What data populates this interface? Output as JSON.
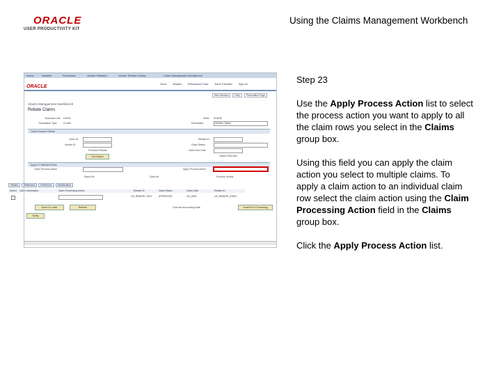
{
  "header": {
    "logo_brand": "ORACLE",
    "logo_product": "USER PRODUCTIVITY KIT",
    "doc_title": "Using the Claims Management Workbench"
  },
  "screenshot": {
    "nav_items": [
      "Home",
      "Worklist",
      "Processes",
      "Vendor Rebates",
      "Vendor Rebate Claims",
      "Claim Management Workbench"
    ],
    "brand": "ORACLE",
    "menu_items": [
      "Home",
      "Worklist",
      "Performance Trace",
      "Add to Favorites",
      "Sign out"
    ],
    "links": [
      "New Window",
      "Help",
      "Personalize Page"
    ],
    "page_title_small": "Claims Management Workbench",
    "page_title": "Rebate Claims",
    "fields": {
      "business_unit": "Business Unit",
      "business_unit_value": "US001",
      "transaction_type": "Transaction Type",
      "transaction_type_value": "CLAIM",
      "setid": "SetID",
      "setid_value": "SHARE",
      "description": "Description",
      "description_value": "Rebate Claims",
      "claim_id": "Claim ID",
      "vendor_id": "Vendor ID",
      "rebate_id": "Rebate ID",
      "claim_status": "Claim Status",
      "claim_due_date": "Claim Due Date",
      "purchase_rebate": "Purchase Rebate",
      "claims_past_due": "Claims Past Due"
    },
    "search_section": "Claims Search Criteria",
    "get_claims": "Get Claims",
    "apply_section": "Apply To Selected Rows",
    "process_action_label": "Claim Process Action",
    "apply_process_action_label": "Apply Process Action",
    "select_all": "Select All",
    "clear_all": "Clear All",
    "process_vendor": "Process Vendor",
    "claims_section": "Claims",
    "tabs": [
      "Details",
      "Settlement",
      "Reference",
      "Identification"
    ],
    "grid_headers": [
      "Select",
      "Claim Information",
      "Claim Processing Action",
      "Rebate ID",
      "Claim Status",
      "Claim Date",
      "Rebate ID"
    ],
    "grid_row": [
      "US_REBATE_0001",
      "APPROVED",
      "US_0001",
      "US_REBATE_00001"
    ],
    "override_label": "Override Accounting Date",
    "save_for_later": "Save For Later",
    "refresh": "Refresh",
    "submit_processing": "Submit For Processing",
    "notify": "Notify"
  },
  "panel": {
    "step": "Step 23",
    "p1": {
      "t1": "Use the ",
      "b1": "Apply Process Action",
      "t2": " list to select the process action you want to apply to all the claim rows you select in the ",
      "b2": "Claims",
      "t3": " group box."
    },
    "p2": {
      "t1": "Using this field you can apply the claim action you select to multiple claims. To apply a claim action to an individual claim row select the claim action using the ",
      "b1": "Claim Processing Action",
      "t2": " field in the ",
      "b2": "Claims",
      "t3": " group box."
    },
    "p3": {
      "t1": "Click the ",
      "b1": "Apply Process Action",
      "t2": " list."
    }
  }
}
